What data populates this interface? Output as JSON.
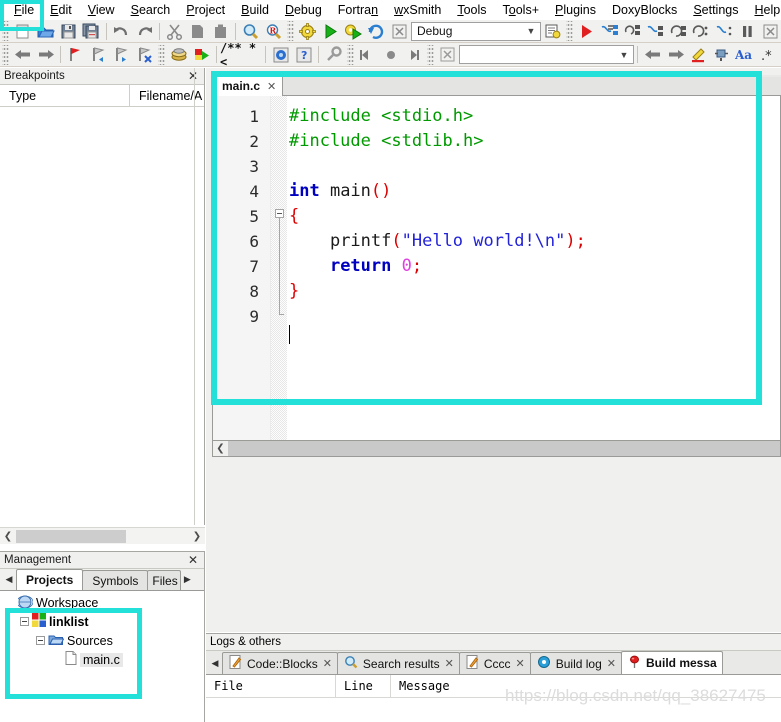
{
  "app": {
    "name": "Code::Blocks"
  },
  "menubar": {
    "items": [
      {
        "label": "File",
        "mnemonic": "F",
        "name": "menu-file"
      },
      {
        "label": "Edit",
        "mnemonic": "E",
        "name": "menu-edit"
      },
      {
        "label": "View",
        "mnemonic": "V",
        "name": "menu-view"
      },
      {
        "label": "Search",
        "mnemonic": "S",
        "name": "menu-search"
      },
      {
        "label": "Project",
        "mnemonic": "P",
        "name": "menu-project"
      },
      {
        "label": "Build",
        "mnemonic": "B",
        "name": "menu-build"
      },
      {
        "label": "Debug",
        "mnemonic": "D",
        "name": "menu-debug"
      },
      {
        "label": "Fortran",
        "mnemonic": "n",
        "name": "menu-fortran"
      },
      {
        "label": "wxSmith",
        "mnemonic": "w",
        "name": "menu-wxsmith"
      },
      {
        "label": "Tools",
        "mnemonic": "T",
        "name": "menu-tools"
      },
      {
        "label": "Tools+",
        "mnemonic": "o",
        "name": "menu-tools-plus"
      },
      {
        "label": "Plugins",
        "mnemonic": "P",
        "name": "menu-plugins"
      },
      {
        "label": "DoxyBlocks",
        "mnemonic": "",
        "name": "menu-doxyblocks"
      },
      {
        "label": "Settings",
        "mnemonic": "S",
        "name": "menu-settings"
      },
      {
        "label": "Help",
        "mnemonic": "H",
        "name": "menu-help"
      }
    ]
  },
  "toolbar1": {
    "icons": [
      "new-file-icon",
      "open-file-icon",
      "save-icon",
      "save-all-icon",
      "undo-icon",
      "redo-icon",
      "cut-icon",
      "copy-icon",
      "paste-icon",
      "find-icon",
      "replace-icon",
      "build-icon",
      "run-icon",
      "build-and-run-icon",
      "rebuild-icon",
      "abort-icon"
    ],
    "target_combo": {
      "value": "Debug",
      "name": "build-target-combo"
    },
    "select_target_icon": "select-target-icon",
    "debug_icons": [
      "debug-continue-icon",
      "debug-run-to-cursor-icon",
      "debug-next-line-icon",
      "debug-step-into-icon",
      "debug-step-out-icon",
      "debug-next-instruction-icon",
      "debug-step-into-instruction-icon",
      "debug-break-icon",
      "debug-stop-icon"
    ]
  },
  "toolbar2": {
    "nav_icons": [
      "back-icon",
      "forward-icon"
    ],
    "bookmark_icons": [
      "toggle-bookmark-icon",
      "prev-bookmark-icon",
      "next-bookmark-icon",
      "clear-bookmarks-icon"
    ],
    "misc_icons": [
      "class-browser-icon",
      "run-html-help-icon"
    ],
    "comment_label": "/** *<",
    "help_icons": [
      "codeblocks-help-icon",
      "context-help-icon",
      "doxyblocks-config-icon"
    ],
    "debugger_icons": [
      "debug-step-back-icon",
      "debug-point-icon",
      "debug-step-forward-icon",
      "debug-stop-icon"
    ],
    "goto_combo": {
      "value": "",
      "placeholder": "",
      "name": "goto-symbol-combo"
    },
    "right_icons": [
      "prev-changed-line-icon",
      "next-changed-line-icon",
      "highlight-icon",
      "insert-icon",
      "match-case-icon",
      "regex-icon"
    ]
  },
  "breakpoints_panel": {
    "title": "Breakpoints",
    "close_label": "✕",
    "columns": [
      "Type",
      "Filename/A"
    ],
    "rows": []
  },
  "management_panel": {
    "title": "Management",
    "close_label": "✕",
    "tabs": [
      {
        "label": "Projects",
        "active": true
      },
      {
        "label": "Symbols",
        "active": false
      },
      {
        "label": "Files",
        "active": false
      }
    ],
    "tree": [
      {
        "label": "Workspace",
        "depth": 0,
        "icon": "workspace-icon",
        "bold": false,
        "selected": false
      },
      {
        "label": "linklist",
        "depth": 1,
        "icon": "project-icon",
        "bold": true,
        "selected": false
      },
      {
        "label": "Sources",
        "depth": 2,
        "icon": "folder-icon",
        "bold": false,
        "selected": false
      },
      {
        "label": "main.c",
        "depth": 3,
        "icon": "file-icon",
        "bold": false,
        "selected": true
      }
    ]
  },
  "editor": {
    "tabs": [
      {
        "label": "main.c",
        "close_label": "✕",
        "active": true
      }
    ],
    "lines": [
      {
        "num": "1",
        "indent": 0,
        "tokens": [
          {
            "t": "#include <stdio.h>",
            "c": "k-pre"
          }
        ]
      },
      {
        "num": "2",
        "indent": 0,
        "tokens": [
          {
            "t": "#include <stdlib.h>",
            "c": "k-pre"
          }
        ]
      },
      {
        "num": "3",
        "indent": 0,
        "tokens": []
      },
      {
        "num": "4",
        "indent": 0,
        "tokens": [
          {
            "t": "int",
            "c": "k-kw"
          },
          {
            "t": " main",
            "c": "k-id"
          },
          {
            "t": "()",
            "c": "k-punct"
          }
        ]
      },
      {
        "num": "5",
        "indent": 0,
        "tokens": [
          {
            "t": "{",
            "c": "k-brace"
          }
        ]
      },
      {
        "num": "6",
        "indent": 4,
        "tokens": [
          {
            "t": "printf",
            "c": "k-id"
          },
          {
            "t": "(",
            "c": "k-punct"
          },
          {
            "t": "\"Hello world!\\n\"",
            "c": "k-str"
          },
          {
            "t": ")",
            "c": "k-punct"
          },
          {
            "t": ";",
            "c": "k-punct"
          }
        ]
      },
      {
        "num": "7",
        "indent": 4,
        "tokens": [
          {
            "t": "return",
            "c": "k-kw"
          },
          {
            "t": " ",
            "c": "k-id"
          },
          {
            "t": "0",
            "c": "k-num"
          },
          {
            "t": ";",
            "c": "k-punct"
          }
        ]
      },
      {
        "num": "8",
        "indent": 0,
        "tokens": [
          {
            "t": "}",
            "c": "k-brace"
          }
        ]
      },
      {
        "num": "9",
        "indent": 0,
        "tokens": []
      }
    ]
  },
  "logs_panel": {
    "title": "Logs & others",
    "tabs": [
      {
        "label": "Code::Blocks",
        "icon": "pencil-icon",
        "close_label": "✕",
        "active": false
      },
      {
        "label": "Search results",
        "icon": "search-icon",
        "close_label": "✕",
        "active": false
      },
      {
        "label": "Cccc",
        "icon": "pencil-icon",
        "close_label": "✕",
        "active": false
      },
      {
        "label": "Build log",
        "icon": "gear-blue-icon",
        "close_label": "✕",
        "active": false
      },
      {
        "label": "Build messa",
        "icon": "pin-icon",
        "close_label": "",
        "active": true
      }
    ],
    "columns": [
      "File",
      "Line",
      "Message"
    ],
    "rows": []
  },
  "watermark": {
    "text": "https://blog.csdn.net/qq_38627475"
  },
  "highlights": {
    "color": "#23e0d8",
    "regions": [
      "file-menu",
      "code-editor",
      "project-tree"
    ]
  }
}
